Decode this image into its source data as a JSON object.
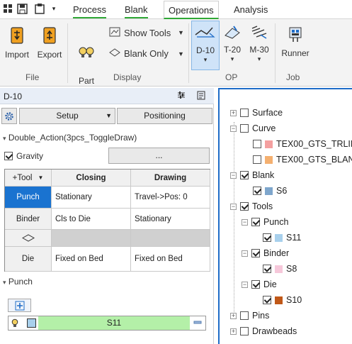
{
  "tabs": [
    {
      "label": "Process"
    },
    {
      "label": "Blank"
    },
    {
      "label": "Operations"
    },
    {
      "label": "Analysis"
    }
  ],
  "ribbon": {
    "file": {
      "import": "Import",
      "export": "Export",
      "group": "File"
    },
    "display": {
      "part_on_off": "Part\nOn/Off",
      "show_tools": "Show Tools",
      "blank_only": "Blank Only",
      "group": "Display"
    },
    "op": {
      "d10": "D-10",
      "t20": "T-20",
      "m30": "M-30",
      "group": "OP"
    },
    "job": {
      "runner": "Runner",
      "group": "Job"
    }
  },
  "panel": {
    "title": "D-10",
    "setup": "Setup",
    "positioning": "Positioning",
    "action": "Double_Action(3pcs_ToggleDraw)",
    "gravity": "Gravity",
    "ellipsis": "...",
    "grid_headers": [
      "+Tool",
      "Closing",
      "Drawing"
    ],
    "rows": [
      {
        "tool": "Punch",
        "closing": "Stationary",
        "drawing": "Travel->Pos: 0"
      },
      {
        "tool": "Binder",
        "closing": "Cls to Die",
        "drawing": "Stationary"
      },
      {
        "tool": "",
        "closing": "",
        "drawing": ""
      },
      {
        "tool": "Die",
        "closing": "Fixed on Bed",
        "drawing": "Fixed on Bed"
      }
    ],
    "punch_section": "Punch",
    "punch_item": "S11"
  },
  "tree": {
    "surface": "Surface",
    "curve": "Curve",
    "curve1": "TEX00_GTS_TRLINE",
    "curve2": "TEX00_GTS_BLANK",
    "blank": "Blank",
    "s6": "S6",
    "tools": "Tools",
    "punch": "Punch",
    "s11": "S11",
    "binder": "Binder",
    "s8": "S8",
    "die": "Die",
    "s10": "S10",
    "pins": "Pins",
    "drawbeads": "Drawbeads"
  },
  "colors": {
    "accent_green": "#2fa836",
    "selection_blue": "#1a73d0",
    "s11_green": "#b4f0a8",
    "curve1": "#f4a0a0",
    "curve2": "#f4b070",
    "s6": "#7ea6cc",
    "s11": "#a8d0ec",
    "s8": "#f6c8da",
    "s10": "#c05818"
  }
}
